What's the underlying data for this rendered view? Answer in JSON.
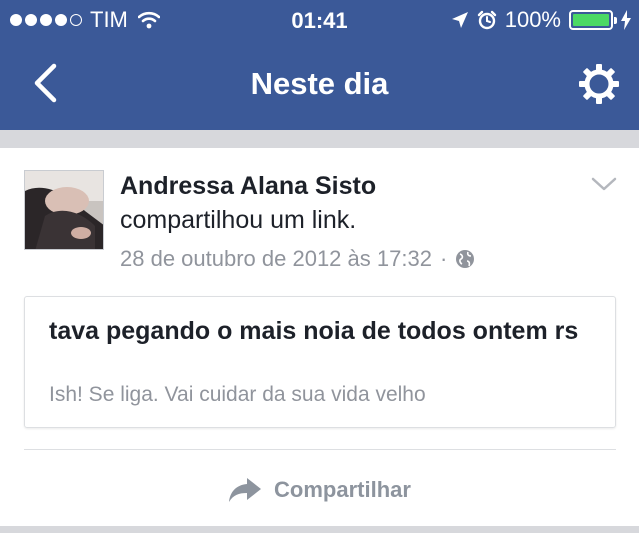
{
  "status_bar": {
    "carrier": "TIM",
    "time": "01:41",
    "battery_percent": "100%",
    "battery_level": 1.0,
    "signal_bars_filled": 4,
    "signal_bars_total": 5
  },
  "nav": {
    "title": "Neste dia",
    "back_icon": "chevron-left-icon",
    "settings_icon": "gear-icon"
  },
  "post": {
    "author": "Andressa Alana Sisto",
    "action": "compartilhou um link.",
    "date": "28 de outubro de 2012 às 17:32",
    "separator": "·",
    "privacy_icon": "globe-icon",
    "link": {
      "title": "tava pegando o mais noia de todos ontem rs",
      "description": "Ish! Se liga. Vai cuidar da sua vida velho"
    },
    "share_label": "Compartilhar"
  },
  "colors": {
    "brand": "#3b5998",
    "battery": "#4cd964",
    "muted_text": "#90949c",
    "strip": "#d7d8dc"
  }
}
